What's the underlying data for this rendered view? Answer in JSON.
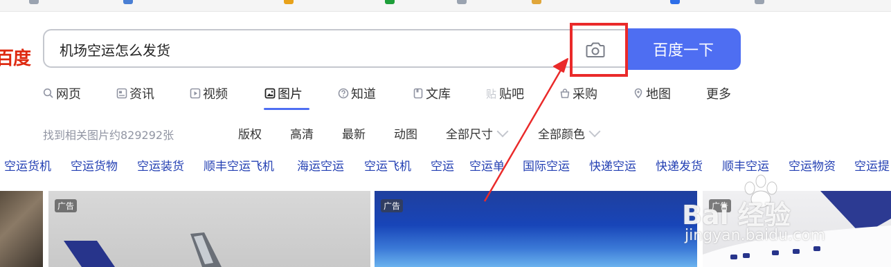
{
  "logo": {
    "text": "百度"
  },
  "search": {
    "query": "机场空运怎么发货",
    "button_label": "百度一下",
    "camera_icon": "camera-icon"
  },
  "tabs": [
    {
      "label": "网页",
      "icon": "search-icon"
    },
    {
      "label": "资讯",
      "icon": "news-icon"
    },
    {
      "label": "视频",
      "icon": "video-icon"
    },
    {
      "label": "图片",
      "icon": "image-icon",
      "active": true
    },
    {
      "label": "知道",
      "icon": "question-icon"
    },
    {
      "label": "文库",
      "icon": "document-icon"
    },
    {
      "label": "贴吧",
      "icon": "tieba-icon"
    },
    {
      "label": "采购",
      "icon": "shopping-icon"
    },
    {
      "label": "地图",
      "icon": "map-icon"
    },
    {
      "label": "更多"
    }
  ],
  "filters": {
    "result_count": "找到相关图片约829292张",
    "items": [
      {
        "label": "版权"
      },
      {
        "label": "高清"
      },
      {
        "label": "最新"
      },
      {
        "label": "动图"
      },
      {
        "label": "全部尺寸",
        "dropdown": true
      },
      {
        "label": "全部颜色",
        "dropdown": true
      }
    ]
  },
  "related": [
    "空运货机",
    "空运货物",
    "空运装货",
    "顺丰空运飞机",
    "海运空运",
    "空运飞机",
    "空运",
    "空运单",
    "国际空运",
    "快递空运",
    "快递发货",
    "顺丰空运",
    "空运物资",
    "空运提"
  ],
  "images": [
    {
      "ad": ""
    },
    {
      "ad": "广告"
    },
    {
      "ad": "广告"
    },
    {
      "ad": "广告"
    }
  ],
  "watermark": {
    "brand": "Bai  经验",
    "url": "jingyan.baidu.com"
  },
  "colors": {
    "accent": "#4e6ef2",
    "link": "#2440b3",
    "annotation": "#ea2a2a",
    "logo": "#de2910"
  }
}
